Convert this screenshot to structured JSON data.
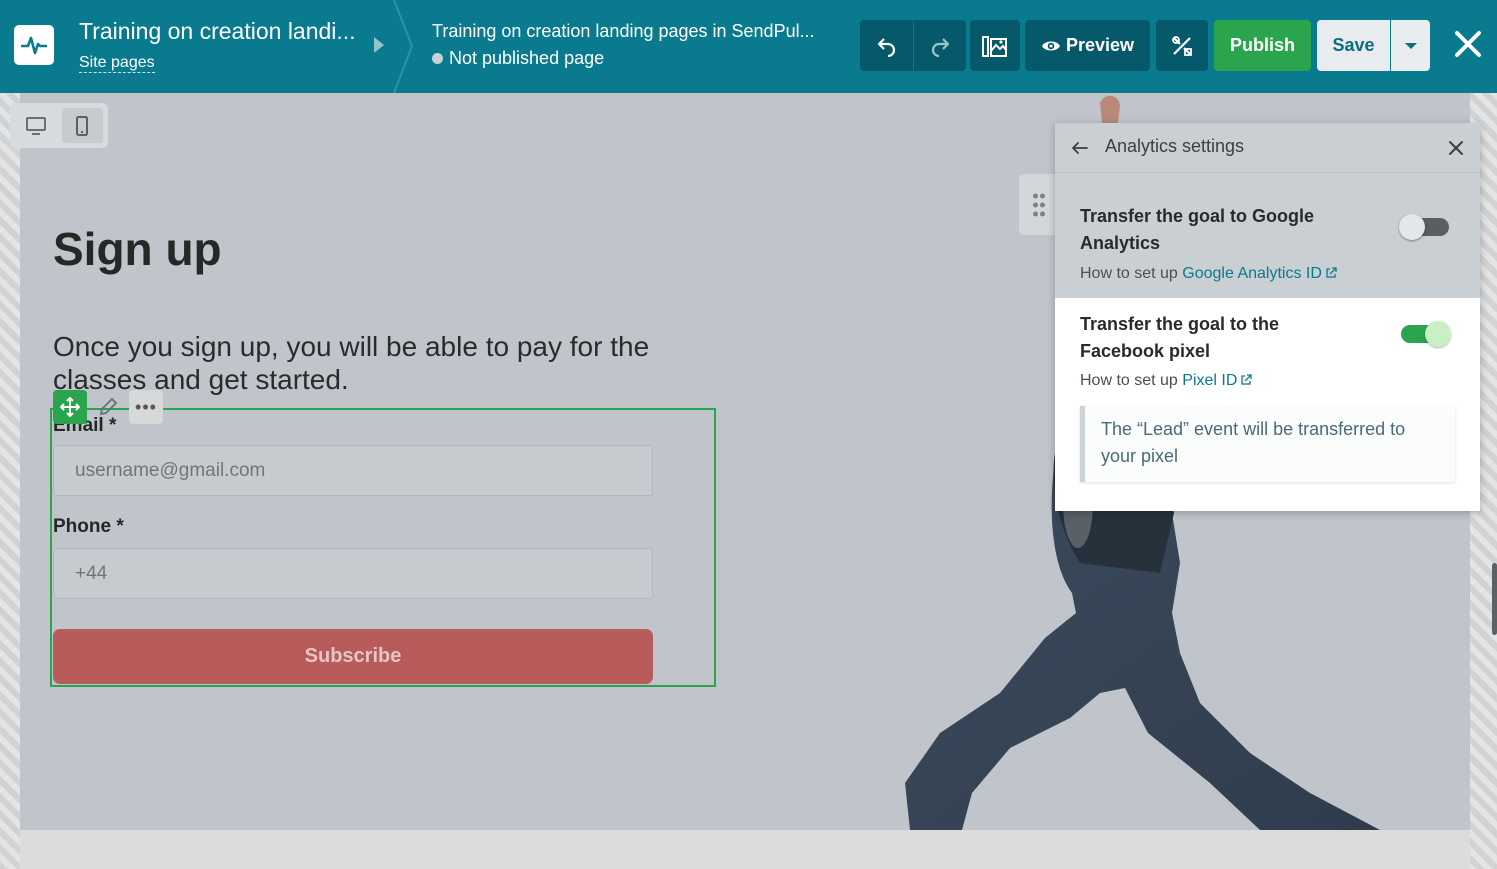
{
  "topbar": {
    "site_title": "Training on creation landi...",
    "site_pages_link": "Site pages",
    "page_name": "Training on creation landing pages in SendPul...",
    "page_status": "Not published page",
    "preview_label": "Preview",
    "publish_label": "Publish",
    "save_label": "Save",
    "icons": [
      "pulse-logo-icon",
      "undo-icon",
      "redo-icon",
      "gallery-icon",
      "eye-icon",
      "tools-icon",
      "chevron-down-icon",
      "close-icon"
    ],
    "colors": {
      "bar": "#0a7a8e",
      "publish": "#2ba44e",
      "save_bg": "#e9ecee"
    }
  },
  "device_switch": {
    "options": [
      "desktop",
      "mobile"
    ],
    "active": "mobile"
  },
  "page": {
    "heading": "Sign up",
    "subtitle": "Once you sign up, you will be able to pay for the classes and get started.",
    "form": {
      "email_label": "Email *",
      "email_placeholder": "username@gmail.com",
      "phone_label": "Phone *",
      "phone_value": "+44",
      "subscribe_label": "Subscribe"
    }
  },
  "analytics_panel": {
    "title": "Analytics settings",
    "google": {
      "title": "Transfer the goal to Google Analytics",
      "help_prefix": "How to set up",
      "help_link": "Google Analytics ID",
      "enabled": false
    },
    "facebook": {
      "title": "Transfer the goal to the Facebook pixel",
      "help_prefix": "How to set up",
      "help_link": "Pixel ID",
      "enabled": true,
      "info": "The “Lead” event will be transferred to your pixel"
    }
  }
}
